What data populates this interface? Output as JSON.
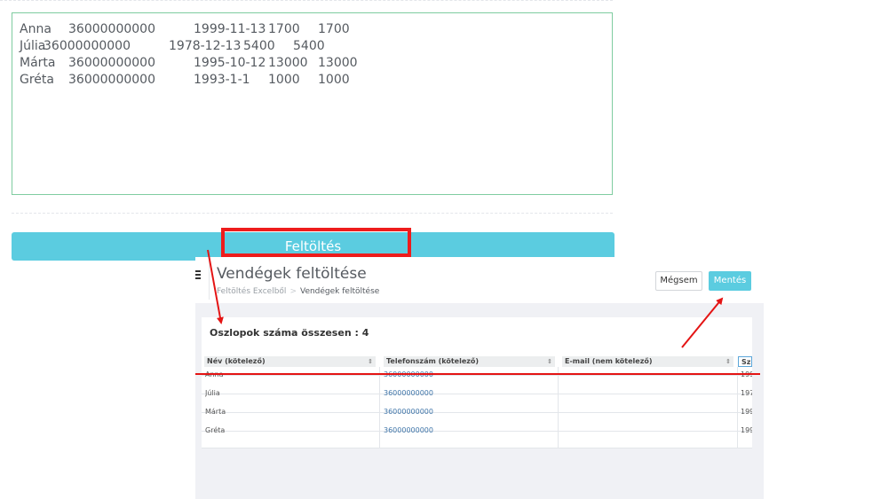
{
  "textarea": {
    "rows": [
      {
        "name": "Anna",
        "phone": "36000000000",
        "date": "1999-11-13",
        "v1": "1700",
        "v2": "1700"
      },
      {
        "name": "Júlia",
        "phone": "36000000000",
        "date": "1978-12-13",
        "v1": "5400",
        "v2": "5400"
      },
      {
        "name": "Márta",
        "phone": "36000000000",
        "date": "1995-10-12",
        "v1": "13000",
        "v2": "13000"
      },
      {
        "name": "Gréta",
        "phone": "36000000000",
        "date": "1993-1-1",
        "v1": "1000",
        "v2": "1000"
      }
    ]
  },
  "upload_button": {
    "label": "Feltöltés"
  },
  "panel": {
    "title": "Vendégek feltöltése",
    "breadcrumb": {
      "parent": "Feltöltés Excelből",
      "separator": ">",
      "current": "Vendégek feltöltése"
    },
    "cancel_label": "Mégsem",
    "save_label": "Mentés",
    "column_count_label": "Oszlopok száma összesen : 4",
    "headers": [
      "Név (kötelező)",
      "Telefonszám (kötelező)",
      "E-mail (nem kötelező)",
      "Sz"
    ],
    "rows": [
      {
        "name": "Anna",
        "phone": "36000000000",
        "email": "",
        "date": "199"
      },
      {
        "name": "Júlia",
        "phone": "36000000000",
        "email": "",
        "date": "197"
      },
      {
        "name": "Márta",
        "phone": "36000000000",
        "email": "",
        "date": "199"
      },
      {
        "name": "Gréta",
        "phone": "36000000000",
        "email": "",
        "date": "199"
      }
    ]
  },
  "icons": {
    "menu": "hamburger-icon",
    "sort": "sort-icon"
  },
  "colors": {
    "accent": "#5bcce0",
    "textarea_border": "#7fcca0",
    "annotation": "#e41414",
    "link": "#3e74a8"
  }
}
